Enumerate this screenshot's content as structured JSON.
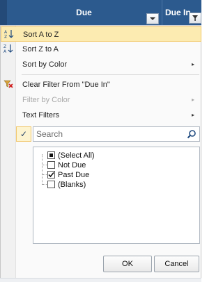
{
  "header": {
    "columns": [
      {
        "label": "Due"
      },
      {
        "label": "Due In"
      }
    ]
  },
  "menu": {
    "items": [
      {
        "label": "Sort A to Z",
        "icon": "sort-ascending-icon",
        "highlighted": true
      },
      {
        "label": "Sort Z to A",
        "icon": "sort-descending-icon"
      },
      {
        "label": "Sort by Color",
        "submenu": true
      },
      {
        "label": "Clear Filter From \"Due In\"",
        "icon": "clear-filter-icon"
      },
      {
        "label": "Filter by Color",
        "submenu": true,
        "disabled": true
      },
      {
        "label": "Text Filters",
        "submenu": true
      }
    ],
    "submenu_glyph": "▸"
  },
  "search": {
    "placeholder": "Search"
  },
  "filter_list": {
    "items": [
      {
        "label": "(Select All)",
        "state": "partial"
      },
      {
        "label": "Not Due",
        "state": "unchecked"
      },
      {
        "label": "Past Due",
        "state": "checked"
      },
      {
        "label": "(Blanks)",
        "state": "unchecked"
      }
    ]
  },
  "buttons": {
    "ok": "OK",
    "cancel": "Cancel"
  },
  "gutter_check": "✓",
  "colors": {
    "header_bg": "#2c5a8e",
    "highlight_bg": "#fcebb1",
    "highlight_border": "#f2c96b"
  }
}
